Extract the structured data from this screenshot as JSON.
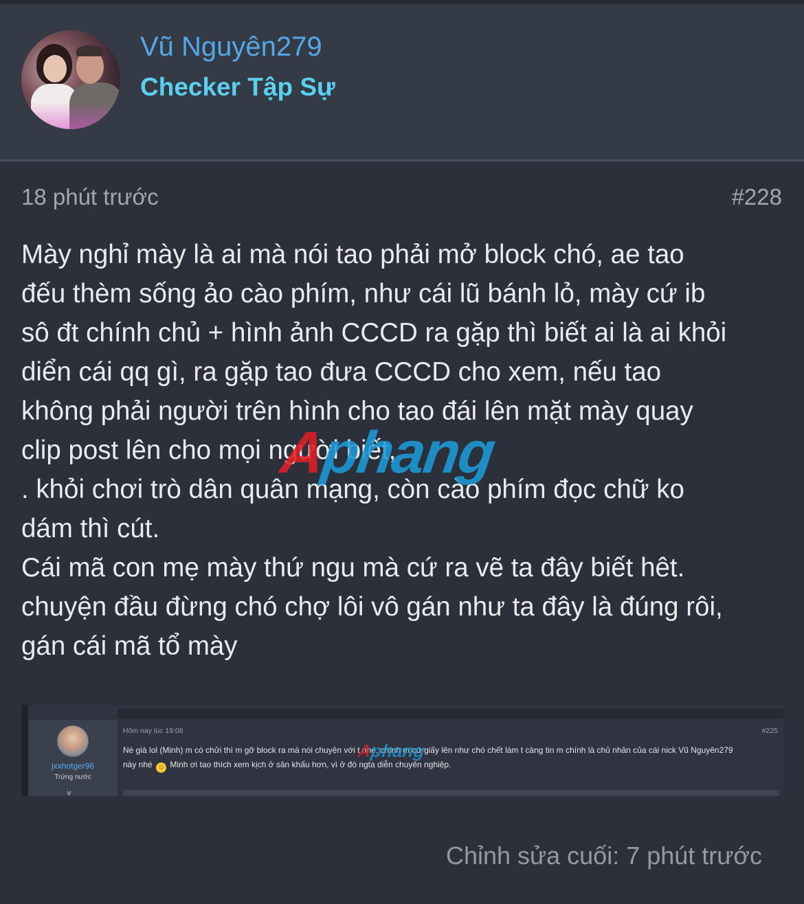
{
  "user": {
    "name": "Vũ Nguyên279",
    "title": "Checker Tập Sự"
  },
  "post": {
    "time": "18 phút trước",
    "number": "#228",
    "lines": [
      "Mày nghỉ mày là ai mà nói tao phải mở block chó, ae tao",
      "đếu thèm sống ảo cào phím, như cái lũ bánh lỏ, mày cứ ib",
      "sô đt chính chủ + hình ảnh CCCD ra gặp thì biết ai là ai khỏi",
      "diển cái qq gì, ra gặp tao đưa CCCD cho xem, nếu tao",
      "không phải người trên hình cho tao đái lên mặt mày quay",
      "clip post lên cho mọi người biết,",
      ". khỏi chơi trò dân quân mạng, còn cào phím đọc chữ ko",
      "dám thì cút.",
      "Cái mã con mẹ mày thứ ngu mà cứ ra vẽ ta đây biết hêt.",
      "chuyện đầu đừng chó chợ lôi vô gán như ta đây là đúng rôi,",
      "gán cái mã tổ mày"
    ],
    "edited": "Chỉnh sửa cuối: 7 phút trước"
  },
  "watermark": {
    "part1": "A",
    "part2": "phang"
  },
  "quote": {
    "username": "jxxhotger96",
    "rank": "Trứng nước",
    "more": "˅",
    "time": "Hôm nay lúc 19:08",
    "number": "#225",
    "text1": "Nè già lol (Minh) m có chửi thì m gỡ block ra mà nói chuyện với t nhé, chính m cứ giấy lên như chó chết làm t càng tin m chính là chủ nhân của cái nick Vũ Nguyên279",
    "text2": "này nhé",
    "emoji": "🙂",
    "text3": "Minh ơi tao thích xem kịch ở sân khấu hơn, vì ở đó ngta diễn chuyên nghiệp."
  },
  "colors": {
    "background": "#2b303b",
    "header": "#343a46",
    "username": "#53a9e8",
    "title": "#5ad1ef"
  }
}
